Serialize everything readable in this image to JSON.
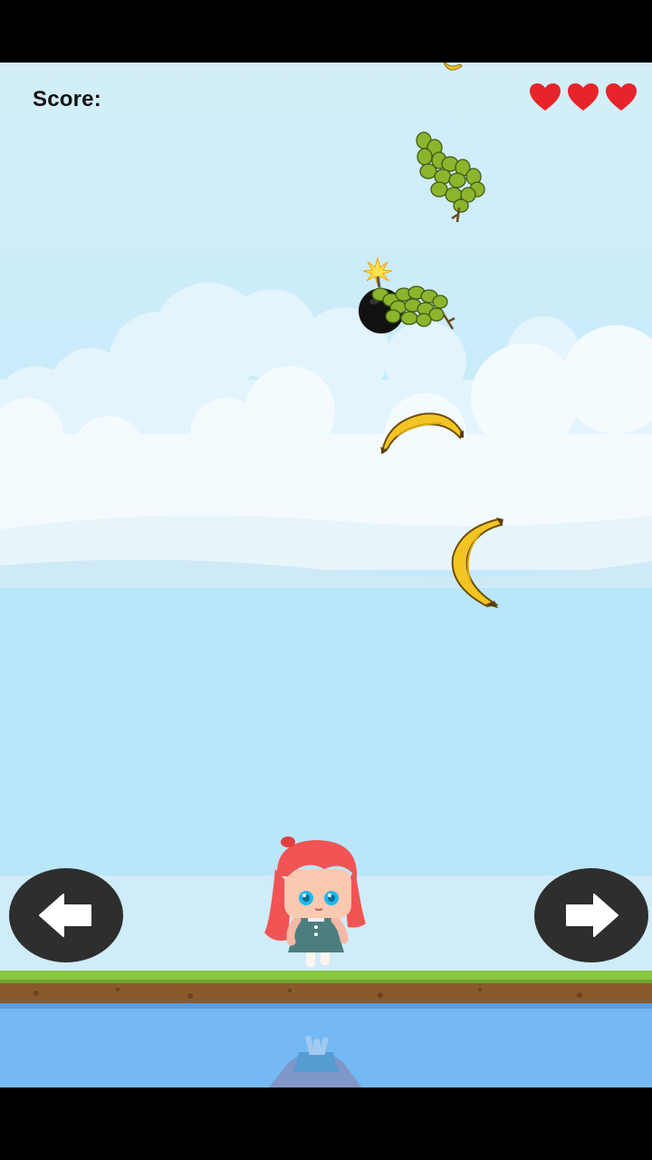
{
  "hud": {
    "score_label": "Score:",
    "score_value": "",
    "lives": 3
  },
  "colors": {
    "sky_top": "#cfeefb",
    "sky_bottom": "#b7e5f8",
    "water": "#74b9f4",
    "grass": "#8bc63f",
    "dirt": "#8b5a2b",
    "heart": "#e8242b",
    "control_bg": "#2e2e2e"
  },
  "falling_items": [
    "banana",
    "grapes",
    "bomb",
    "grapes",
    "banana",
    "banana"
  ],
  "controls": {
    "left": "arrow-left-icon",
    "right": "arrow-right-icon"
  },
  "player": "girl-character"
}
